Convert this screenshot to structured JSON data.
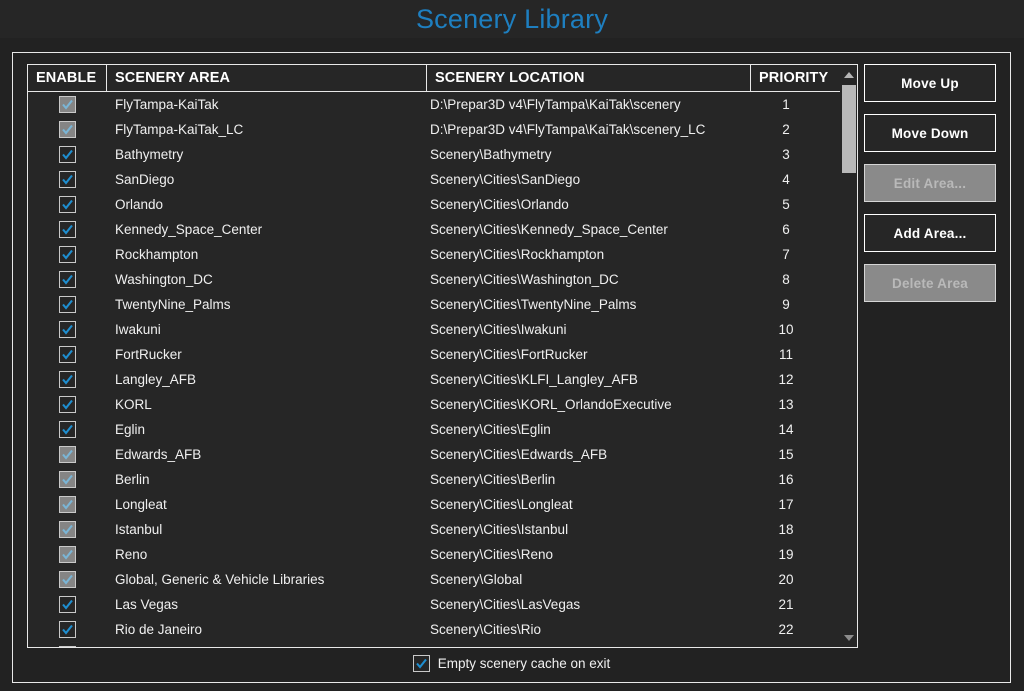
{
  "window": {
    "title": "Scenery Library",
    "title_color": "#1e7fc0",
    "background_color": "#222222"
  },
  "table": {
    "columns": [
      {
        "key": "enable",
        "label": "ENABLE"
      },
      {
        "key": "area",
        "label": "SCENERY AREA"
      },
      {
        "key": "location",
        "label": "SCENERY LOCATION"
      },
      {
        "key": "priority",
        "label": "PRIORITY"
      }
    ],
    "rows": [
      {
        "enabled": true,
        "checkbox_style": "gray",
        "area": "FlyTampa-KaiTak",
        "location": "D:\\Prepar3D v4\\FlyTampa\\KaiTak\\scenery",
        "priority": "1"
      },
      {
        "enabled": true,
        "checkbox_style": "gray",
        "area": "FlyTampa-KaiTak_LC",
        "location": "D:\\Prepar3D v4\\FlyTampa\\KaiTak\\scenery_LC",
        "priority": "2"
      },
      {
        "enabled": true,
        "checkbox_style": "dark",
        "area": "Bathymetry",
        "location": "Scenery\\Bathymetry",
        "priority": "3"
      },
      {
        "enabled": true,
        "checkbox_style": "dark",
        "area": "SanDiego",
        "location": "Scenery\\Cities\\SanDiego",
        "priority": "4"
      },
      {
        "enabled": true,
        "checkbox_style": "dark",
        "area": "Orlando",
        "location": "Scenery\\Cities\\Orlando",
        "priority": "5"
      },
      {
        "enabled": true,
        "checkbox_style": "dark",
        "area": "Kennedy_Space_Center",
        "location": "Scenery\\Cities\\Kennedy_Space_Center",
        "priority": "6"
      },
      {
        "enabled": true,
        "checkbox_style": "dark",
        "area": "Rockhampton",
        "location": "Scenery\\Cities\\Rockhampton",
        "priority": "7"
      },
      {
        "enabled": true,
        "checkbox_style": "dark",
        "area": "Washington_DC",
        "location": "Scenery\\Cities\\Washington_DC",
        "priority": "8"
      },
      {
        "enabled": true,
        "checkbox_style": "dark",
        "area": "TwentyNine_Palms",
        "location": "Scenery\\Cities\\TwentyNine_Palms",
        "priority": "9"
      },
      {
        "enabled": true,
        "checkbox_style": "dark",
        "area": "Iwakuni",
        "location": "Scenery\\Cities\\Iwakuni",
        "priority": "10"
      },
      {
        "enabled": true,
        "checkbox_style": "dark",
        "area": "FortRucker",
        "location": "Scenery\\Cities\\FortRucker",
        "priority": "11"
      },
      {
        "enabled": true,
        "checkbox_style": "dark",
        "area": "Langley_AFB",
        "location": "Scenery\\Cities\\KLFI_Langley_AFB",
        "priority": "12"
      },
      {
        "enabled": true,
        "checkbox_style": "dark",
        "area": "KORL",
        "location": "Scenery\\Cities\\KORL_OrlandoExecutive",
        "priority": "13"
      },
      {
        "enabled": true,
        "checkbox_style": "dark",
        "area": "Eglin",
        "location": "Scenery\\Cities\\Eglin",
        "priority": "14"
      },
      {
        "enabled": true,
        "checkbox_style": "gray",
        "area": "Edwards_AFB",
        "location": "Scenery\\Cities\\Edwards_AFB",
        "priority": "15"
      },
      {
        "enabled": true,
        "checkbox_style": "gray",
        "area": "Berlin",
        "location": "Scenery\\Cities\\Berlin",
        "priority": "16"
      },
      {
        "enabled": true,
        "checkbox_style": "gray",
        "area": "Longleat",
        "location": "Scenery\\Cities\\Longleat",
        "priority": "17"
      },
      {
        "enabled": true,
        "checkbox_style": "gray",
        "area": "Istanbul",
        "location": "Scenery\\Cities\\Istanbul",
        "priority": "18"
      },
      {
        "enabled": true,
        "checkbox_style": "gray",
        "area": "Reno",
        "location": "Scenery\\Cities\\Reno",
        "priority": "19"
      },
      {
        "enabled": true,
        "checkbox_style": "gray",
        "area": "Global, Generic & Vehicle Libraries",
        "location": "Scenery\\Global",
        "priority": "20"
      },
      {
        "enabled": true,
        "checkbox_style": "dark",
        "area": "Las Vegas",
        "location": "Scenery\\Cities\\LasVegas",
        "priority": "21"
      },
      {
        "enabled": true,
        "checkbox_style": "dark",
        "area": "Rio de Janeiro",
        "location": "Scenery\\Cities\\Rio",
        "priority": "22"
      }
    ]
  },
  "scrollbar": {
    "up_icon": "triangle-up-icon",
    "down_icon": "triangle-down-icon",
    "thumb_position": "top"
  },
  "buttons": [
    {
      "label": "Move Up",
      "name": "move-up-button",
      "disabled": false
    },
    {
      "label": "Move Down",
      "name": "move-down-button",
      "disabled": false
    },
    {
      "label": "Edit Area...",
      "name": "edit-area-button",
      "disabled": true
    },
    {
      "label": "Add Area...",
      "name": "add-area-button",
      "disabled": false
    },
    {
      "label": "Delete Area",
      "name": "delete-area-button",
      "disabled": true
    }
  ],
  "bottom_option": {
    "label": "Empty scenery cache on exit",
    "checked": true
  }
}
